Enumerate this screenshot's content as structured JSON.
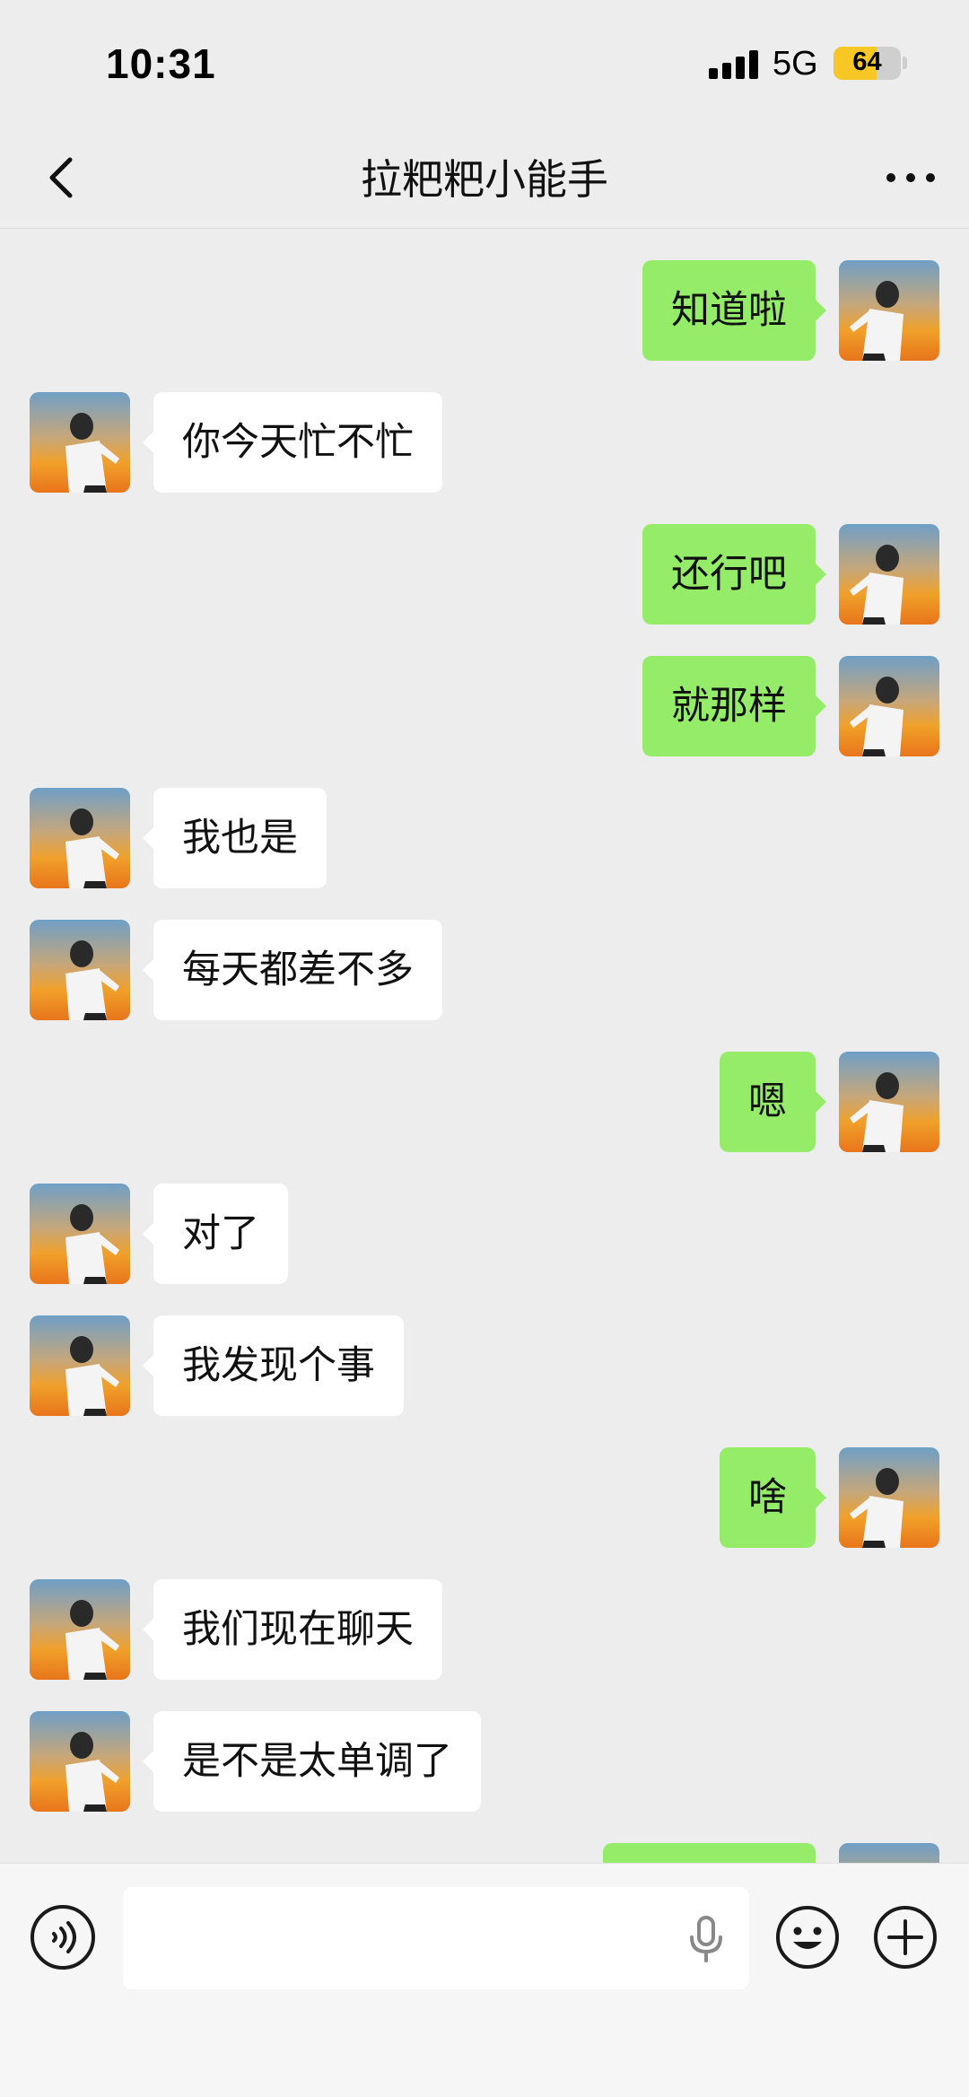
{
  "status_bar": {
    "time": "10:31",
    "network": "5G",
    "battery_percent": "64",
    "battery_level": 0.64
  },
  "nav": {
    "title": "拉粑粑小能手"
  },
  "messages": [
    {
      "side": "right",
      "text": "知道啦"
    },
    {
      "side": "left",
      "text": "你今天忙不忙"
    },
    {
      "side": "right",
      "text": "还行吧"
    },
    {
      "side": "right",
      "text": "就那样"
    },
    {
      "side": "left",
      "text": "我也是"
    },
    {
      "side": "left",
      "text": "每天都差不多"
    },
    {
      "side": "right",
      "text": "嗯"
    },
    {
      "side": "left",
      "text": "对了"
    },
    {
      "side": "left",
      "text": "我发现个事"
    },
    {
      "side": "right",
      "text": "啥"
    },
    {
      "side": "left",
      "text": "我们现在聊天"
    },
    {
      "side": "left",
      "text": "是不是太单调了"
    },
    {
      "side": "right",
      "text": ""
    }
  ],
  "input": {
    "value": "",
    "placeholder": ""
  },
  "icons": {
    "back": "chevron-left-icon",
    "more": "more-icon",
    "voice": "voice-icon",
    "mic": "microphone-icon",
    "emoji": "emoji-icon",
    "plus": "plus-icon"
  },
  "colors": {
    "background": "#ededed",
    "sent_bubble": "#95ec69",
    "received_bubble": "#ffffff",
    "battery": "#f7c825"
  }
}
